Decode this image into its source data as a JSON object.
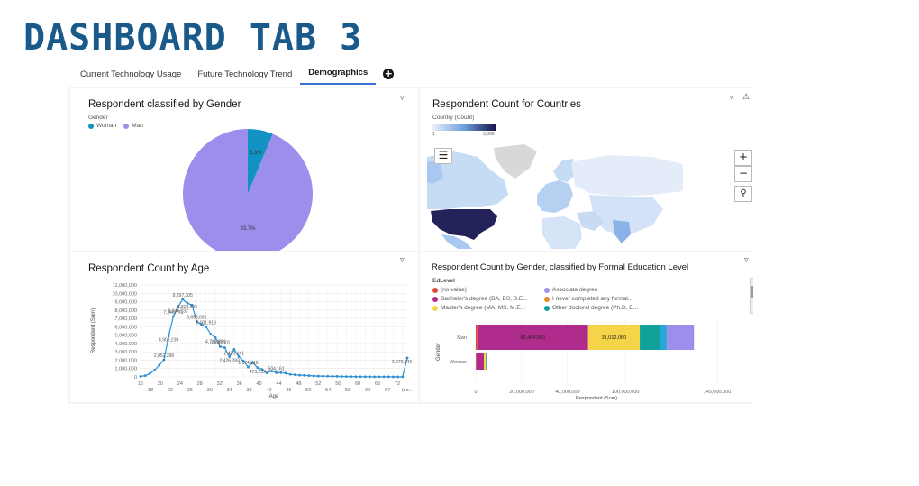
{
  "slide": {
    "title": "DASHBOARD TAB 3"
  },
  "tabs": [
    {
      "label": "Current Technology Usage"
    },
    {
      "label": "Future Technology Trend"
    },
    {
      "label": "Demographics"
    }
  ],
  "gender_panel": {
    "title": "Respondent classified by Gender",
    "legend_title": "Gender",
    "legend": [
      {
        "label": "Woman",
        "color": "#1192c3"
      },
      {
        "label": "Man",
        "color": "#9b8feb"
      }
    ],
    "slices": [
      {
        "label": "6.3%",
        "value": 6.3,
        "color": "#1192c3"
      },
      {
        "label": "93.7%",
        "value": 93.7,
        "color": "#9b8feb"
      }
    ]
  },
  "country_panel": {
    "title": "Respondent Count for Countries",
    "legend_title": "Country (Count)",
    "scale_min": "1",
    "scale_max": "3,000",
    "icons": [
      "filter-icon",
      "warning-icon",
      "layers-icon",
      "zoom-in-icon",
      "zoom-out-icon",
      "search-icon"
    ]
  },
  "age_panel": {
    "title": "Respondent Count by Age",
    "ylabel": "Respondent (Sum)",
    "xlabel": "Age",
    "y_ticks": [
      "0",
      "1,000,000",
      "2,000,000",
      "3,000,000",
      "4,000,000",
      "5,000,000",
      "6,000,000",
      "7,000,000",
      "8,000,000",
      "9,000,000",
      "10,000,000",
      "11,000,000"
    ],
    "x_ticks_top": [
      "16",
      "20",
      "24",
      "28",
      "32",
      "36",
      "40",
      "44",
      "48",
      "52",
      "56",
      "60",
      "65",
      "72"
    ],
    "x_ticks_bottom": [
      "18",
      "22",
      "26",
      "30",
      "34",
      "38",
      "42",
      "46",
      "50",
      "54",
      "58",
      "62",
      "67",
      "(no..."
    ],
    "point_labels": [
      "9,297,305",
      "8,344,232",
      "7,246,771",
      "8,823,696",
      "6,653,091",
      "4,909,239",
      "6,001,919",
      "4,715,884",
      "3,620,501",
      "2,429,141",
      "2,052,398",
      "2,426,283",
      "1,174,819",
      "473,232",
      "504,161",
      "2,270,046"
    ]
  },
  "chart_data": [
    {
      "type": "pie",
      "title": "Respondent classified by Gender",
      "categories": [
        "Woman",
        "Man"
      ],
      "values": [
        6.3,
        93.7
      ]
    },
    {
      "type": "line",
      "title": "Respondent Count by Age",
      "xlabel": "Age",
      "ylabel": "Respondent (Sum)",
      "ylim": [
        0,
        11000000
      ],
      "x": [
        16,
        17,
        18,
        19,
        20,
        21,
        22,
        23,
        24,
        25,
        26,
        27,
        28,
        29,
        30,
        31,
        32,
        33,
        34,
        35,
        36,
        37,
        38,
        39,
        40,
        41,
        42,
        43,
        44,
        45,
        46,
        47,
        48,
        49,
        50,
        51,
        52,
        53,
        54,
        55,
        56,
        57,
        58,
        59,
        60,
        61,
        62,
        63,
        64,
        65,
        66,
        67,
        68,
        69,
        70,
        71,
        72,
        "(no value)"
      ],
      "series": [
        {
          "name": "Respondent (Sum)",
          "values": [
            50000,
            150000,
            400000,
            800000,
            1400000,
            2052398,
            4909239,
            7246771,
            8344232,
            9297305,
            8823696,
            8600000,
            6653091,
            6300000,
            6001919,
            5100000,
            4715884,
            3620501,
            3500000,
            2426283,
            3300000,
            2429141,
            1900000,
            1174819,
            1700000,
            1100000,
            900000,
            473232,
            700000,
            504161,
            500000,
            450000,
            300000,
            250000,
            200000,
            180000,
            150000,
            120000,
            100000,
            90000,
            80000,
            70000,
            60000,
            50000,
            40000,
            35000,
            30000,
            25000,
            20000,
            20000,
            15000,
            12000,
            10000,
            8000,
            6000,
            5000,
            4000,
            2270046
          ]
        }
      ]
    },
    {
      "type": "bar",
      "title": "Respondent Count by Gender, classified by Formal Education Level",
      "xlabel": "Respondent (Sum)",
      "ylabel": "Gender",
      "categories": [
        "Man",
        "Woman"
      ],
      "xlim": [
        0,
        145000000
      ],
      "series": [
        {
          "name": "(no value)",
          "values": [
            1000000,
            400000
          ]
        },
        {
          "name": "Associate degree",
          "values": [
            0,
            0
          ]
        },
        {
          "name": "Bachelor's degree (BA, BS, B.E...",
          "values": [
            66484053,
            4500000
          ]
        },
        {
          "name": "I never completed any formal...",
          "values": [
            0,
            0
          ]
        },
        {
          "name": "Master's degree (MA, MS, M.E...",
          "values": [
            31012060,
            1200000
          ]
        },
        {
          "name": "Other doctoral degree (Ph.D, E...",
          "values": [
            12000000,
            800000
          ]
        }
      ]
    }
  ],
  "edu_panel": {
    "title": "Respondent Count by Gender, classified by Formal Education Level",
    "legend_title": "EdLevel",
    "legend": [
      {
        "label": "(no value)",
        "color": "#e0463d"
      },
      {
        "label": "Associate degree",
        "color": "#9b8feb"
      },
      {
        "label": "Bachelor's degree (BA, BS, B.E...",
        "color": "#b02c8c"
      },
      {
        "label": "I never completed any formal...",
        "color": "#e8892a"
      },
      {
        "label": "Master's degree (MA, MS, M.E...",
        "color": "#f5d547"
      },
      {
        "label": "Other doctoral degree (Ph.D, E...",
        "color": "#12a09b"
      }
    ],
    "ylabel": "Gender",
    "xlabel": "Respondent (Sum)",
    "bar_label_bachelor": "66,484,053",
    "bar_label_master": "31,012,060",
    "x_ticks": [
      "0",
      "20,000,000",
      "40,000,000",
      "100,000,000",
      "145,000,000"
    ],
    "categories": [
      "Man",
      "Woman"
    ]
  }
}
